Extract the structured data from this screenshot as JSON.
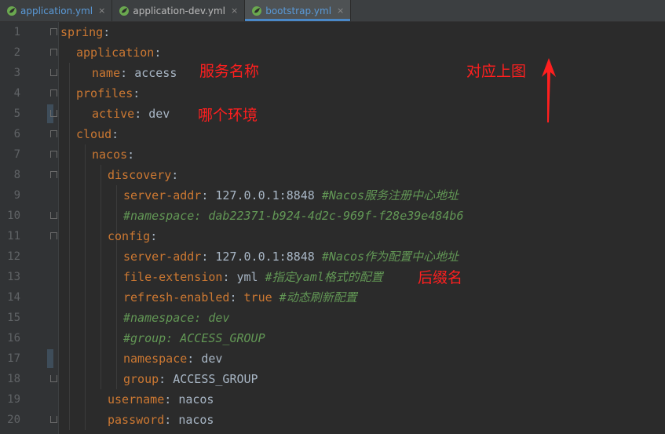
{
  "tabs": [
    {
      "label": "application.yml",
      "active": false
    },
    {
      "label": "application-dev.yml",
      "active": false
    },
    {
      "label": "bootstrap.yml",
      "active": true
    }
  ],
  "tab_close_glyph": "×",
  "line_numbers": [
    "1",
    "2",
    "3",
    "4",
    "5",
    "6",
    "7",
    "8",
    "9",
    "10",
    "11",
    "12",
    "13",
    "14",
    "15",
    "16",
    "17",
    "18",
    "19",
    "20"
  ],
  "code": [
    {
      "key": "spring",
      "sep": ":",
      "value": "",
      "comment": ""
    },
    {
      "key": "application",
      "sep": ":",
      "value": "",
      "comment": ""
    },
    {
      "key": "name",
      "sep": ": ",
      "value": "access",
      "comment": ""
    },
    {
      "key": "profiles",
      "sep": ":",
      "value": "",
      "comment": ""
    },
    {
      "key": "active",
      "sep": ": ",
      "value": "dev",
      "comment": ""
    },
    {
      "key": "cloud",
      "sep": ":",
      "value": "",
      "comment": ""
    },
    {
      "key": "nacos",
      "sep": ":",
      "value": "",
      "comment": ""
    },
    {
      "key": "discovery",
      "sep": ":",
      "value": "",
      "comment": ""
    },
    {
      "key": "server-addr",
      "sep": ": ",
      "value": "127.0.0.1:8848",
      "comment": " #Nacos服务注册中心地址"
    },
    {
      "key": "",
      "sep": "",
      "value": "",
      "comment": "#namespace: dab22371-b924-4d2c-969f-f28e39e484b6"
    },
    {
      "key": "config",
      "sep": ":",
      "value": "",
      "comment": ""
    },
    {
      "key": "server-addr",
      "sep": ": ",
      "value": "127.0.0.1:8848",
      "comment": " #Nacos作为配置中心地址"
    },
    {
      "key": "file-extension",
      "sep": ": ",
      "value": "yml",
      "comment": " #指定yaml格式的配置"
    },
    {
      "key": "refresh-enabled",
      "sep": ": ",
      "value": "true",
      "comment": " #动态刷新配置"
    },
    {
      "key": "",
      "sep": "",
      "value": "",
      "comment": "#namespace: dev"
    },
    {
      "key": "",
      "sep": "",
      "value": "",
      "comment": "#group: ACCESS_GROUP"
    },
    {
      "key": "namespace",
      "sep": ": ",
      "value": "dev",
      "comment": ""
    },
    {
      "key": "group",
      "sep": ": ",
      "value": "ACCESS_GROUP",
      "comment": ""
    },
    {
      "key": "username",
      "sep": ": ",
      "value": "nacos",
      "comment": ""
    },
    {
      "key": "password",
      "sep": ": ",
      "value": "nacos",
      "comment": ""
    }
  ],
  "annotations": {
    "service_name": "服务名称",
    "which_env": "哪个环境",
    "corresponds_above": "对应上图",
    "suffix_name": "后缀名"
  },
  "colors": {
    "background": "#2b2b2b",
    "key": "#cc7832",
    "comment": "#629755",
    "annotation": "#ff1f1f",
    "active_tab_underline": "#4a88c7"
  }
}
